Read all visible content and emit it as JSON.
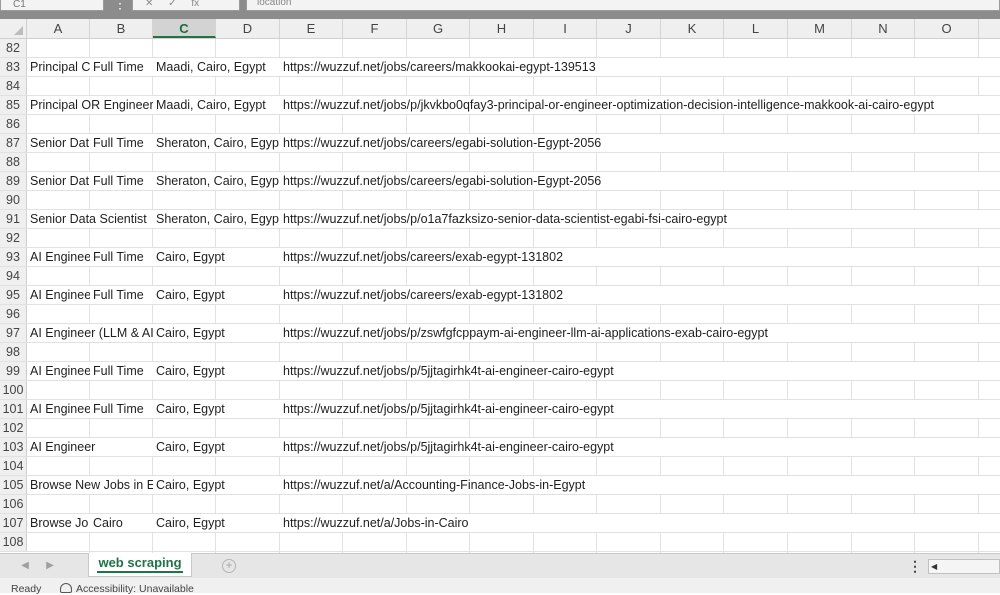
{
  "formula_bar": {
    "name_box": "C1",
    "controls": [
      "✕",
      "✓",
      "fx"
    ],
    "content": "location"
  },
  "columns": [
    "A",
    "B",
    "C",
    "D",
    "E",
    "F",
    "G",
    "H",
    "I",
    "J",
    "K",
    "L",
    "M",
    "N",
    "O"
  ],
  "active_column": "C",
  "rows": [
    {
      "num": "82",
      "a": "",
      "b": "",
      "c": "",
      "e": ""
    },
    {
      "num": "83",
      "a": "Principal C",
      "b": "Full Time",
      "c": "Maadi, Cairo, Egypt",
      "e": "https://wuzzuf.net/jobs/careers/makkookai-egypt-139513"
    },
    {
      "num": "84",
      "a": "",
      "b": "",
      "c": "",
      "e": ""
    },
    {
      "num": "85",
      "a": "Principal OR Engineer",
      "b": "",
      "c": "Maadi, Cairo, Egypt",
      "e": "https://wuzzuf.net/jobs/p/jkvkbo0qfay3-principal-or-engineer-optimization-decision-intelligence-makkook-ai-cairo-egypt"
    },
    {
      "num": "86",
      "a": "",
      "b": "",
      "c": "",
      "e": ""
    },
    {
      "num": "87",
      "a": "Senior Dat",
      "b": "Full Time",
      "c": "Sheraton, Cairo, Egyp",
      "e": "https://wuzzuf.net/jobs/careers/egabi-solution-Egypt-2056"
    },
    {
      "num": "88",
      "a": "",
      "b": "",
      "c": "",
      "e": ""
    },
    {
      "num": "89",
      "a": "Senior Dat",
      "b": "Full Time",
      "c": "Sheraton, Cairo, Egyp",
      "e": "https://wuzzuf.net/jobs/careers/egabi-solution-Egypt-2056"
    },
    {
      "num": "90",
      "a": "",
      "b": "",
      "c": "",
      "e": ""
    },
    {
      "num": "91",
      "a": "Senior Data Scientist",
      "b": "",
      "c": "Sheraton, Cairo, Egyp",
      "e": "https://wuzzuf.net/jobs/p/o1a7fazksizo-senior-data-scientist-egabi-fsi-cairo-egypt"
    },
    {
      "num": "92",
      "a": "",
      "b": "",
      "c": "",
      "e": ""
    },
    {
      "num": "93",
      "a": "AI Enginee",
      "b": "Full Time",
      "c": "Cairo, Egypt",
      "e": "https://wuzzuf.net/jobs/careers/exab-egypt-131802"
    },
    {
      "num": "94",
      "a": "",
      "b": "",
      "c": "",
      "e": ""
    },
    {
      "num": "95",
      "a": "AI Enginee",
      "b": "Full Time",
      "c": "Cairo, Egypt",
      "e": "https://wuzzuf.net/jobs/careers/exab-egypt-131802"
    },
    {
      "num": "96",
      "a": "",
      "b": "",
      "c": "",
      "e": ""
    },
    {
      "num": "97",
      "a": "AI Engineer (LLM & AI",
      "b": "",
      "c": "Cairo, Egypt",
      "e": "https://wuzzuf.net/jobs/p/zswfgfcppaym-ai-engineer-llm-ai-applications-exab-cairo-egypt"
    },
    {
      "num": "98",
      "a": "",
      "b": "",
      "c": "",
      "e": ""
    },
    {
      "num": "99",
      "a": "AI Enginee",
      "b": "Full Time",
      "c": "Cairo, Egypt",
      "e": "https://wuzzuf.net/jobs/p/5jjtagirhk4t-ai-engineer-cairo-egypt"
    },
    {
      "num": "100",
      "a": "",
      "b": "",
      "c": "",
      "e": ""
    },
    {
      "num": "101",
      "a": "AI Enginee",
      "b": "Full Time",
      "c": "Cairo, Egypt",
      "e": "https://wuzzuf.net/jobs/p/5jjtagirhk4t-ai-engineer-cairo-egypt"
    },
    {
      "num": "102",
      "a": "",
      "b": "",
      "c": "",
      "e": ""
    },
    {
      "num": "103",
      "a": "AI Engineer",
      "b": "",
      "c": "Cairo, Egypt",
      "e": "https://wuzzuf.net/jobs/p/5jjtagirhk4t-ai-engineer-cairo-egypt"
    },
    {
      "num": "104",
      "a": "",
      "b": "",
      "c": "",
      "e": ""
    },
    {
      "num": "105",
      "a": "Browse New Jobs in E",
      "b": "",
      "c": "Cairo, Egypt",
      "e": "https://wuzzuf.net/a/Accounting-Finance-Jobs-in-Egypt"
    },
    {
      "num": "106",
      "a": "",
      "b": "",
      "c": "",
      "e": ""
    },
    {
      "num": "107",
      "a": "Browse Jo",
      "b": "Cairo",
      "c": "Cairo, Egypt",
      "e": "https://wuzzuf.net/a/Jobs-in-Cairo"
    },
    {
      "num": "108",
      "a": "",
      "b": "",
      "c": "",
      "e": ""
    }
  ],
  "sheet_tabs": {
    "active": "web scraping",
    "add_icon": "plus-circle-icon",
    "prev_icon": "chevron-left-icon",
    "next_icon": "chevron-right-icon"
  },
  "status_bar": {
    "ready": "Ready",
    "accessibility": "Accessibility: Unavailable"
  },
  "colors": {
    "accent": "#217346",
    "header_bg": "#efefef",
    "gridline": "#e1e1e1"
  }
}
